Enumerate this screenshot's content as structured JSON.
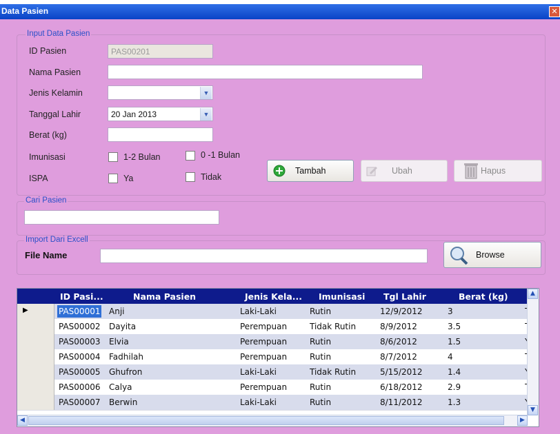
{
  "window": {
    "title": "Data Pasien",
    "close_glyph": "✕"
  },
  "input_group": {
    "legend": "Input Data Pasien",
    "id_label": "ID Pasien",
    "id_value": "PAS00201",
    "nama_label": "Nama Pasien",
    "nama_value": "",
    "jk_label": "Jenis Kelamin",
    "jk_value": "",
    "tgl_label": "Tanggal Lahir",
    "tgl_value": "20 Jan 2013",
    "berat_label": "Berat (kg)",
    "berat_value": "",
    "imunisasi_label": "Imunisasi",
    "imunisasi_opt1": "1-2 Bulan",
    "imunisasi_opt2": "0 -1 Bulan",
    "ispa_label": "ISPA",
    "ispa_opt1": "Ya",
    "ispa_opt2": "Tidak"
  },
  "buttons": {
    "tambah": "Tambah",
    "ubah": "Ubah",
    "hapus": "Hapus",
    "browse": "Browse"
  },
  "search_group": {
    "legend": "Cari Pasien",
    "value": ""
  },
  "import_group": {
    "legend": "Import Dari Excell",
    "file_label": "File Name",
    "file_value": ""
  },
  "grid": {
    "columns": [
      "ID Pasi...",
      "Nama Pasien",
      "Jenis Kela...",
      "Imunisasi",
      "Tgl Lahir",
      "Berat (kg)"
    ],
    "rows": [
      [
        "PAS00001",
        "Anji",
        "Laki-Laki",
        "Rutin",
        "12/9/2012",
        "3",
        "Tid"
      ],
      [
        "PAS00002",
        "Dayita",
        "Perempuan",
        "Tidak Rutin",
        "8/9/2012",
        "3.5",
        "Tid"
      ],
      [
        "PAS00003",
        "Elvia",
        "Perempuan",
        "Rutin",
        "8/6/2012",
        "1.5",
        "Ya"
      ],
      [
        "PAS00004",
        "Fadhilah",
        "Perempuan",
        "Rutin",
        "8/7/2012",
        "4",
        "Tid"
      ],
      [
        "PAS00005",
        "Ghufron",
        "Laki-Laki",
        "Tidak Rutin",
        "5/15/2012",
        "1.4",
        "Ya"
      ],
      [
        "PAS00006",
        "Calya",
        "Perempuan",
        "Rutin",
        "6/18/2012",
        "2.9",
        "Tid"
      ],
      [
        "PAS00007",
        "Berwin",
        "Laki-Laki",
        "Rutin",
        "8/11/2012",
        "1.3",
        "Ya"
      ]
    ],
    "current_row_marker": "▶"
  },
  "colors": {
    "titlebar": "#0a43c6",
    "form_bg": "#df9ddd",
    "grid_header": "#0e1b8c",
    "selected_row": "#d8dcec",
    "legend_text": "#2a50c8"
  }
}
